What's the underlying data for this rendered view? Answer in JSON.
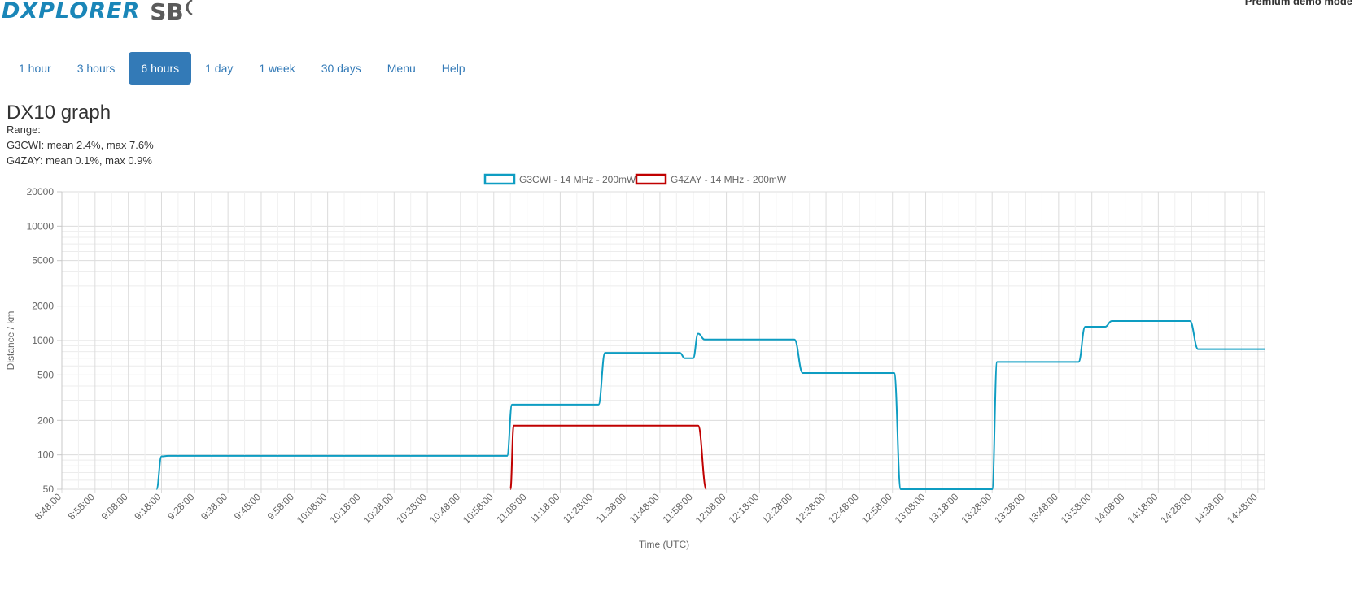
{
  "header": {
    "logo_text": "DXPLORER",
    "logo_sb": "SB",
    "premium_label": "Premium demo mode"
  },
  "tabs": [
    {
      "label": "1 hour",
      "active": false
    },
    {
      "label": "3 hours",
      "active": false
    },
    {
      "label": "6 hours",
      "active": true
    },
    {
      "label": "1 day",
      "active": false
    },
    {
      "label": "1 week",
      "active": false
    },
    {
      "label": "30 days",
      "active": false
    },
    {
      "label": "Menu",
      "active": false
    },
    {
      "label": "Help",
      "active": false
    }
  ],
  "page": {
    "title": "DX10 graph",
    "range_label": "Range:",
    "stats": [
      "G3CWI: mean 2.4%, max 7.6%",
      "G4ZAY: mean 0.1%, max 0.9%"
    ]
  },
  "colors": {
    "accent": "#337ab7",
    "series_1": "#0e9dc2",
    "series_2": "#c00000",
    "grid": "#e0e0e0"
  },
  "chart_data": {
    "type": "line",
    "xlabel": "Time (UTC)",
    "ylabel": "Distance / km",
    "yscale": "log",
    "ylim": [
      50,
      20000
    ],
    "xlim": [
      "8:48:00",
      "14:50:00"
    ],
    "grid": true,
    "legend_position": "top-center",
    "y_ticks": [
      50,
      100,
      200,
      500,
      1000,
      2000,
      5000,
      10000,
      20000
    ],
    "x_ticks": [
      "8:48:00",
      "8:58:00",
      "9:08:00",
      "9:18:00",
      "9:28:00",
      "9:38:00",
      "9:48:00",
      "9:58:00",
      "10:08:00",
      "10:18:00",
      "10:28:00",
      "10:38:00",
      "10:48:00",
      "10:58:00",
      "11:08:00",
      "11:18:00",
      "11:28:00",
      "11:38:00",
      "11:48:00",
      "11:58:00",
      "12:08:00",
      "12:18:00",
      "12:28:00",
      "12:38:00",
      "12:48:00",
      "12:58:00",
      "13:08:00",
      "13:18:00",
      "13:28:00",
      "13:38:00",
      "13:48:00",
      "13:58:00",
      "14:08:00",
      "14:18:00",
      "14:28:00",
      "14:38:00",
      "14:48:00"
    ],
    "series": [
      {
        "name": "G3CWI - 14 MHz - 200mW",
        "points": [
          [
            "9:16:30",
            50
          ],
          [
            "9:18:00",
            97
          ],
          [
            "9:20:00",
            98
          ],
          [
            "11:02:00",
            98
          ],
          [
            "11:03:30",
            275
          ],
          [
            "11:29:30",
            275
          ],
          [
            "11:31:30",
            780
          ],
          [
            "11:54:00",
            780
          ],
          [
            "11:55:30",
            700
          ],
          [
            "11:58:00",
            700
          ],
          [
            "11:59:30",
            1150
          ],
          [
            "12:01:30",
            1020
          ],
          [
            "12:28:30",
            1020
          ],
          [
            "12:31:00",
            520
          ],
          [
            "12:58:30",
            520
          ],
          [
            "13:00:30",
            50
          ],
          [
            "13:28:00",
            50
          ],
          [
            "13:29:30",
            650
          ],
          [
            "13:54:00",
            650
          ],
          [
            "13:56:00",
            1320
          ],
          [
            "14:02:00",
            1320
          ],
          [
            "14:04:00",
            1480
          ],
          [
            "14:27:30",
            1480
          ],
          [
            "14:30:00",
            840
          ],
          [
            "14:50:00",
            840
          ]
        ]
      },
      {
        "name": "G4ZAY - 14 MHz - 200mW",
        "points": [
          [
            "11:03:00",
            50
          ],
          [
            "11:04:00",
            180
          ],
          [
            "11:59:30",
            180
          ],
          [
            "12:02:00",
            50
          ]
        ]
      }
    ]
  }
}
